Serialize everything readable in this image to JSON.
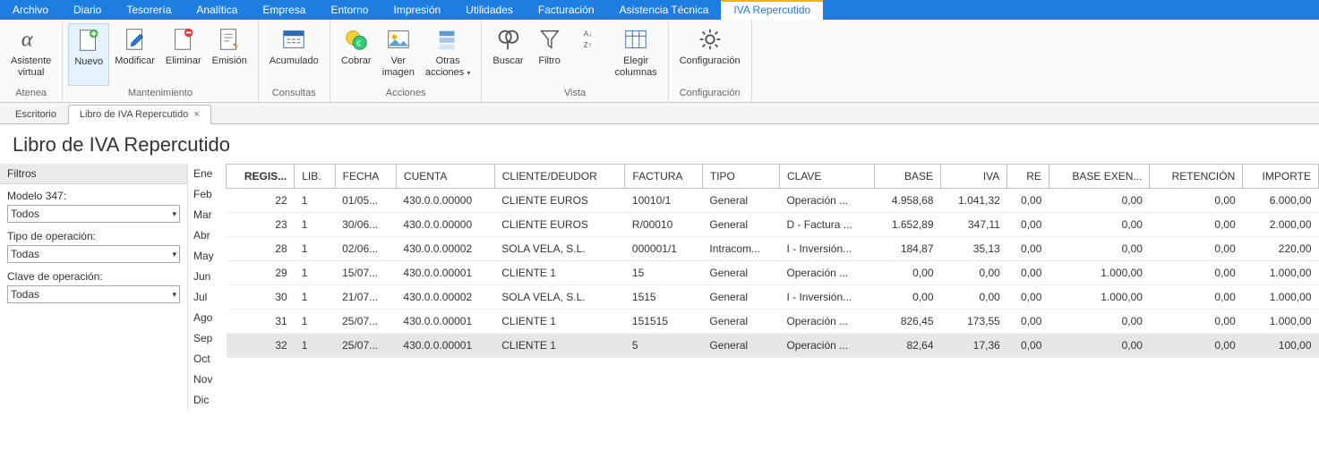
{
  "menubar": {
    "items": [
      "Archivo",
      "Diario",
      "Tesorería",
      "Analítica",
      "Empresa",
      "Entorno",
      "Impresión",
      "Utilidades",
      "Facturación",
      "Asistencia Técnica",
      "IVA Repercutido"
    ],
    "active_index": 10
  },
  "ribbon": {
    "groups": [
      {
        "name": "atenea",
        "label": "Atenea",
        "buttons": [
          {
            "name": "asistente-virtual",
            "label": "Asistente\nvirtual",
            "icon": "alpha-icon"
          }
        ]
      },
      {
        "name": "mantenimiento",
        "label": "Mantenimiento",
        "buttons": [
          {
            "name": "nuevo",
            "label": "Nuevo",
            "icon": "new-doc-icon",
            "highlight": true
          },
          {
            "name": "modificar",
            "label": "Modificar",
            "icon": "edit-doc-icon"
          },
          {
            "name": "eliminar",
            "label": "Eliminar",
            "icon": "delete-doc-icon"
          },
          {
            "name": "emision",
            "label": "Emisión",
            "icon": "emit-doc-icon"
          }
        ]
      },
      {
        "name": "consultas",
        "label": "Consultas",
        "buttons": [
          {
            "name": "acumulado",
            "label": "Acumulado",
            "icon": "sum-icon"
          }
        ]
      },
      {
        "name": "acciones",
        "label": "Acciones",
        "buttons": [
          {
            "name": "cobrar",
            "label": "Cobrar",
            "icon": "money-icon"
          },
          {
            "name": "ver-imagen",
            "label": "Ver\nimagen",
            "icon": "image-icon"
          },
          {
            "name": "otras-acciones",
            "label": "Otras\nacciones",
            "icon": "stack-icon",
            "dropdown": true
          }
        ]
      },
      {
        "name": "vista",
        "label": "Vista",
        "buttons": [
          {
            "name": "buscar",
            "label": "Buscar",
            "icon": "search-icon"
          },
          {
            "name": "filtro",
            "label": "Filtro",
            "icon": "funnel-icon"
          },
          {
            "name": "ordenar",
            "label": "",
            "icon": "sort-icon",
            "narrow": true
          },
          {
            "name": "elegir-columnas",
            "label": "Elegir\ncolumnas",
            "icon": "columns-icon"
          }
        ]
      },
      {
        "name": "configuracion",
        "label": "Configuración",
        "buttons": [
          {
            "name": "configuracion",
            "label": "Configuración",
            "icon": "gear-icon"
          }
        ]
      }
    ]
  },
  "doc_tabs": {
    "items": [
      {
        "label": "Escritorio",
        "closable": false,
        "active": false
      },
      {
        "label": "Libro de IVA Repercutido",
        "closable": true,
        "active": true
      }
    ]
  },
  "page_title": "Libro de IVA Repercutido",
  "filters": {
    "header": "Filtros",
    "modelo_label": "Modelo 347:",
    "modelo_value": "Todos",
    "tipo_label": "Tipo de operación:",
    "tipo_value": "Todas",
    "clave_label": "Clave de operación:",
    "clave_value": "Todas"
  },
  "months": [
    "Ene",
    "Feb",
    "Mar",
    "Abr",
    "May",
    "Jun",
    "Jul",
    "Ago",
    "Sep",
    "Oct",
    "Nov",
    "Dic"
  ],
  "grid": {
    "columns": [
      "REGIS...",
      "LIB.",
      "FECHA",
      "CUENTA",
      "CLIENTE/DEUDOR",
      "FACTURA",
      "TIPO",
      "CLAVE",
      "BASE",
      "IVA",
      "RE",
      "BASE EXEN...",
      "RETENCIÓN",
      "IMPORTE"
    ],
    "rows": [
      {
        "regis": "22",
        "lib": "1",
        "fecha": "01/05...",
        "cuenta": "430.0.0.00000",
        "cliente": "CLIENTE EUROS",
        "factura": "10010/1",
        "tipo": "General",
        "clave": "Operación ...",
        "base": "4.958,68",
        "iva": "1.041,32",
        "re": "0,00",
        "base_exen": "0,00",
        "retencion": "0,00",
        "importe": "6.000,00"
      },
      {
        "regis": "23",
        "lib": "1",
        "fecha": "30/06...",
        "cuenta": "430.0.0.00000",
        "cliente": "CLIENTE EUROS",
        "factura": "R/00010",
        "tipo": "General",
        "clave": "D - Factura ...",
        "base": "1.652,89",
        "iva": "347,11",
        "re": "0,00",
        "base_exen": "0,00",
        "retencion": "0,00",
        "importe": "2.000,00"
      },
      {
        "regis": "28",
        "lib": "1",
        "fecha": "02/06...",
        "cuenta": "430.0.0.00002",
        "cliente": "SOLA VELA, S.L.",
        "factura": "000001/1",
        "tipo": "Intracom...",
        "clave": "I - Inversión...",
        "base": "184,87",
        "iva": "35,13",
        "re": "0,00",
        "base_exen": "0,00",
        "retencion": "0,00",
        "importe": "220,00"
      },
      {
        "regis": "29",
        "lib": "1",
        "fecha": "15/07...",
        "cuenta": "430.0.0.00001",
        "cliente": "CLIENTE 1",
        "factura": "15",
        "tipo": "General",
        "clave": "Operación ...",
        "base": "0,00",
        "iva": "0,00",
        "re": "0,00",
        "base_exen": "1.000,00",
        "retencion": "0,00",
        "importe": "1.000,00"
      },
      {
        "regis": "30",
        "lib": "1",
        "fecha": "21/07...",
        "cuenta": "430.0.0.00002",
        "cliente": "SOLA VELA, S.L.",
        "factura": "1515",
        "tipo": "General",
        "clave": "I - Inversión...",
        "base": "0,00",
        "iva": "0,00",
        "re": "0,00",
        "base_exen": "1.000,00",
        "retencion": "0,00",
        "importe": "1.000,00"
      },
      {
        "regis": "31",
        "lib": "1",
        "fecha": "25/07...",
        "cuenta": "430.0.0.00001",
        "cliente": "CLIENTE 1",
        "factura": "151515",
        "tipo": "General",
        "clave": "Operación ...",
        "base": "826,45",
        "iva": "173,55",
        "re": "0,00",
        "base_exen": "0,00",
        "retencion": "0,00",
        "importe": "1.000,00"
      },
      {
        "regis": "32",
        "lib": "1",
        "fecha": "25/07...",
        "cuenta": "430.0.0.00001",
        "cliente": "CLIENTE 1",
        "factura": "5",
        "tipo": "General",
        "clave": "Operación ...",
        "base": "82,64",
        "iva": "17,36",
        "re": "0,00",
        "base_exen": "0,00",
        "retencion": "0,00",
        "importe": "100,00",
        "selected": true
      }
    ]
  }
}
